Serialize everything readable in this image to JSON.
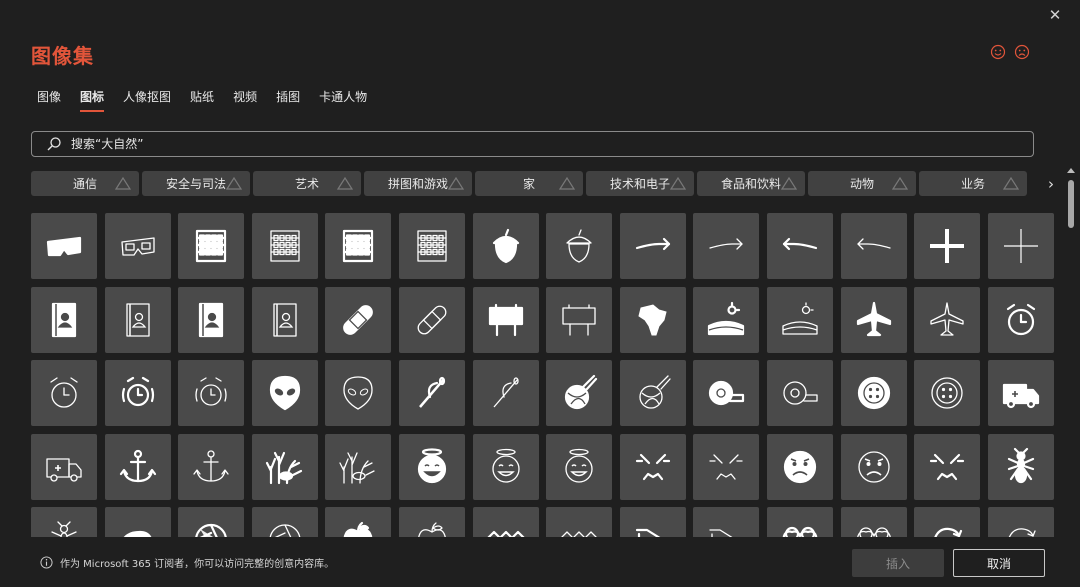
{
  "dialog": {
    "title": "图像集",
    "close_label": "✕"
  },
  "tabs": [
    {
      "label": "图像",
      "active": false
    },
    {
      "label": "图标",
      "active": true
    },
    {
      "label": "人像抠图",
      "active": false
    },
    {
      "label": "贴纸",
      "active": false
    },
    {
      "label": "视频",
      "active": false
    },
    {
      "label": "插图",
      "active": false
    },
    {
      "label": "卡通人物",
      "active": false
    }
  ],
  "search": {
    "placeholder": "搜索“大自然”"
  },
  "categories": [
    "通信",
    "安全与司法",
    "艺术",
    "拼图和游戏",
    "家",
    "技术和电子",
    "食品和饮料",
    "动物",
    "业务"
  ],
  "categories_next": "›",
  "icons": [
    [
      "3d-glasses-icon",
      "3d-glasses-outline-icon",
      "abacus-icon",
      "abacus-outline-icon",
      "abacus-icon",
      "abacus-outline-icon",
      "acorn-icon",
      "acorn-outline-icon",
      "arrow-right-icon",
      "arrow-right-outline-icon",
      "arrow-left-icon",
      "arrow-left-outline-icon",
      "plus-icon",
      "plus-outline-icon"
    ],
    [
      "address-book-icon",
      "address-book-outline-icon",
      "address-book-icon",
      "address-book-outline-icon",
      "bandage-icon",
      "bandage-outline-icon",
      "billboard-icon",
      "billboard-outline-icon",
      "africa-icon",
      "farm-icon",
      "farm-outline-icon",
      "airplane-icon",
      "airplane-outline-icon",
      "alarm-clock-icon"
    ],
    [
      "alarm-clock-outline-icon",
      "alarm-ringing-icon",
      "alarm-ringing-outline-icon",
      "alien-icon",
      "alien-outline-icon",
      "needle-icon",
      "needle-outline-icon",
      "yarn-icon",
      "yarn-outline-icon",
      "measuring-tape-icon",
      "measuring-tape-outline-icon",
      "button-icon",
      "button-outline-icon",
      "ambulance-icon"
    ],
    [
      "ambulance-outline-icon",
      "anchor-icon",
      "anchor-outline-icon",
      "coral-icon",
      "coral-outline-icon",
      "angel-face-icon",
      "angel-face-outline-icon",
      "angel-face-outline-icon",
      "angry-face-icon",
      "angry-face-outline-icon",
      "frown-face-icon",
      "frown-face-outline-icon",
      "angry-face-icon",
      "ant-icon"
    ],
    [
      "ant-outline-icon",
      "anteater-icon",
      "aperture-icon",
      "aperture-outline-icon",
      "apple-icon",
      "apple-outline-icon",
      "wave-icon",
      "wave-outline-icon",
      "bench-icon",
      "bench-outline-icon",
      "hearts-icon",
      "hearts-outline-icon",
      "refresh-icon",
      "refresh-outline-icon"
    ]
  ],
  "footer": {
    "info": "作为 Microsoft 365 订阅者，你可以访问完整的创意内容库。",
    "insert_label": "插入",
    "cancel_label": "取消"
  },
  "colors": {
    "accent": "#e2553a",
    "tile": "#4a4a4a",
    "background": "#1f1f1f"
  }
}
